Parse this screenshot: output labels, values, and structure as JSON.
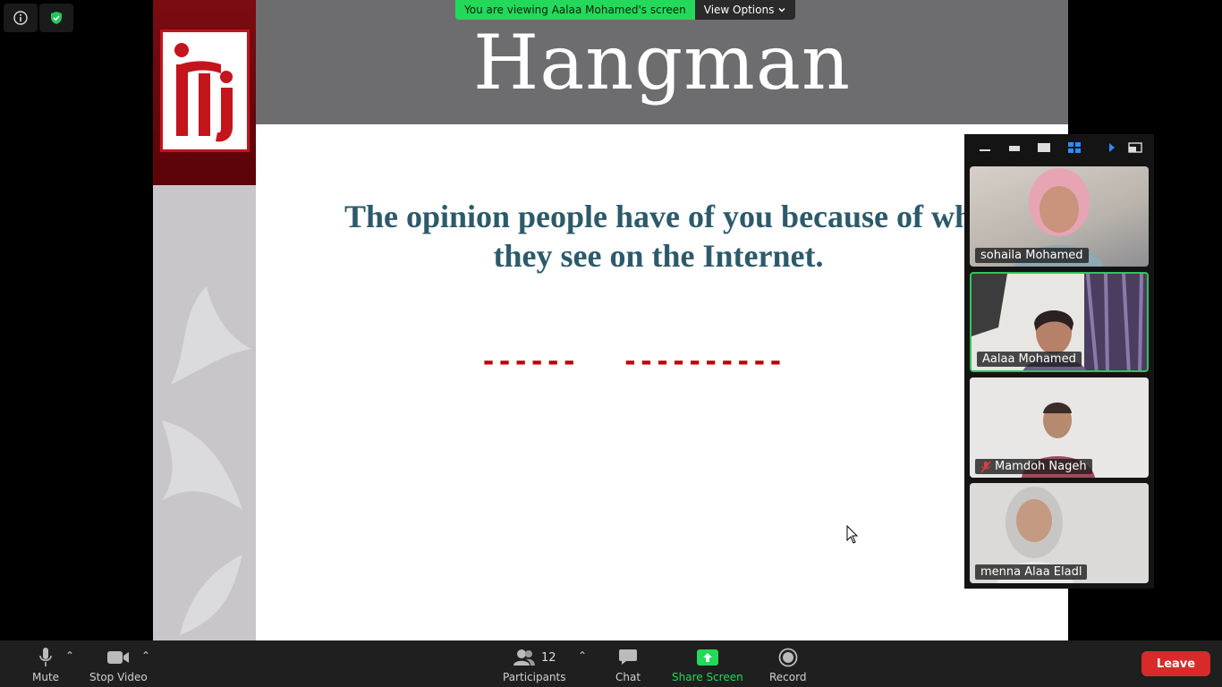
{
  "share_banner": {
    "viewing_text": "You are viewing Aalaa Mohamed's screen",
    "options_label": "View Options"
  },
  "slide": {
    "title": "Hangman",
    "question_line1": "The opinion people have of you because of wh",
    "question_line2": "they see on the Internet.",
    "blank_word1": "------",
    "blank_word2": "----------",
    "logo_text": "iTi"
  },
  "participants": [
    {
      "name": "sohaila Mohamed",
      "muted": false
    },
    {
      "name": "Aalaa Mohamed",
      "muted": false,
      "active": true
    },
    {
      "name": "Mamdoh Nageh",
      "muted": true
    },
    {
      "name": "menna Alaa Eladl",
      "muted": false
    }
  ],
  "toolbar": {
    "mute_label": "Mute",
    "video_label": "Stop Video",
    "participants_label": "Participants",
    "participants_count": "12",
    "chat_label": "Chat",
    "share_label": "Share Screen",
    "record_label": "Record",
    "leave_label": "Leave"
  },
  "colors": {
    "share_green": "#23d959",
    "leave_red": "#d92a2a",
    "active_border": "#2ec55a",
    "slide_text": "#2d5a6b",
    "blank_red": "#c00000"
  }
}
